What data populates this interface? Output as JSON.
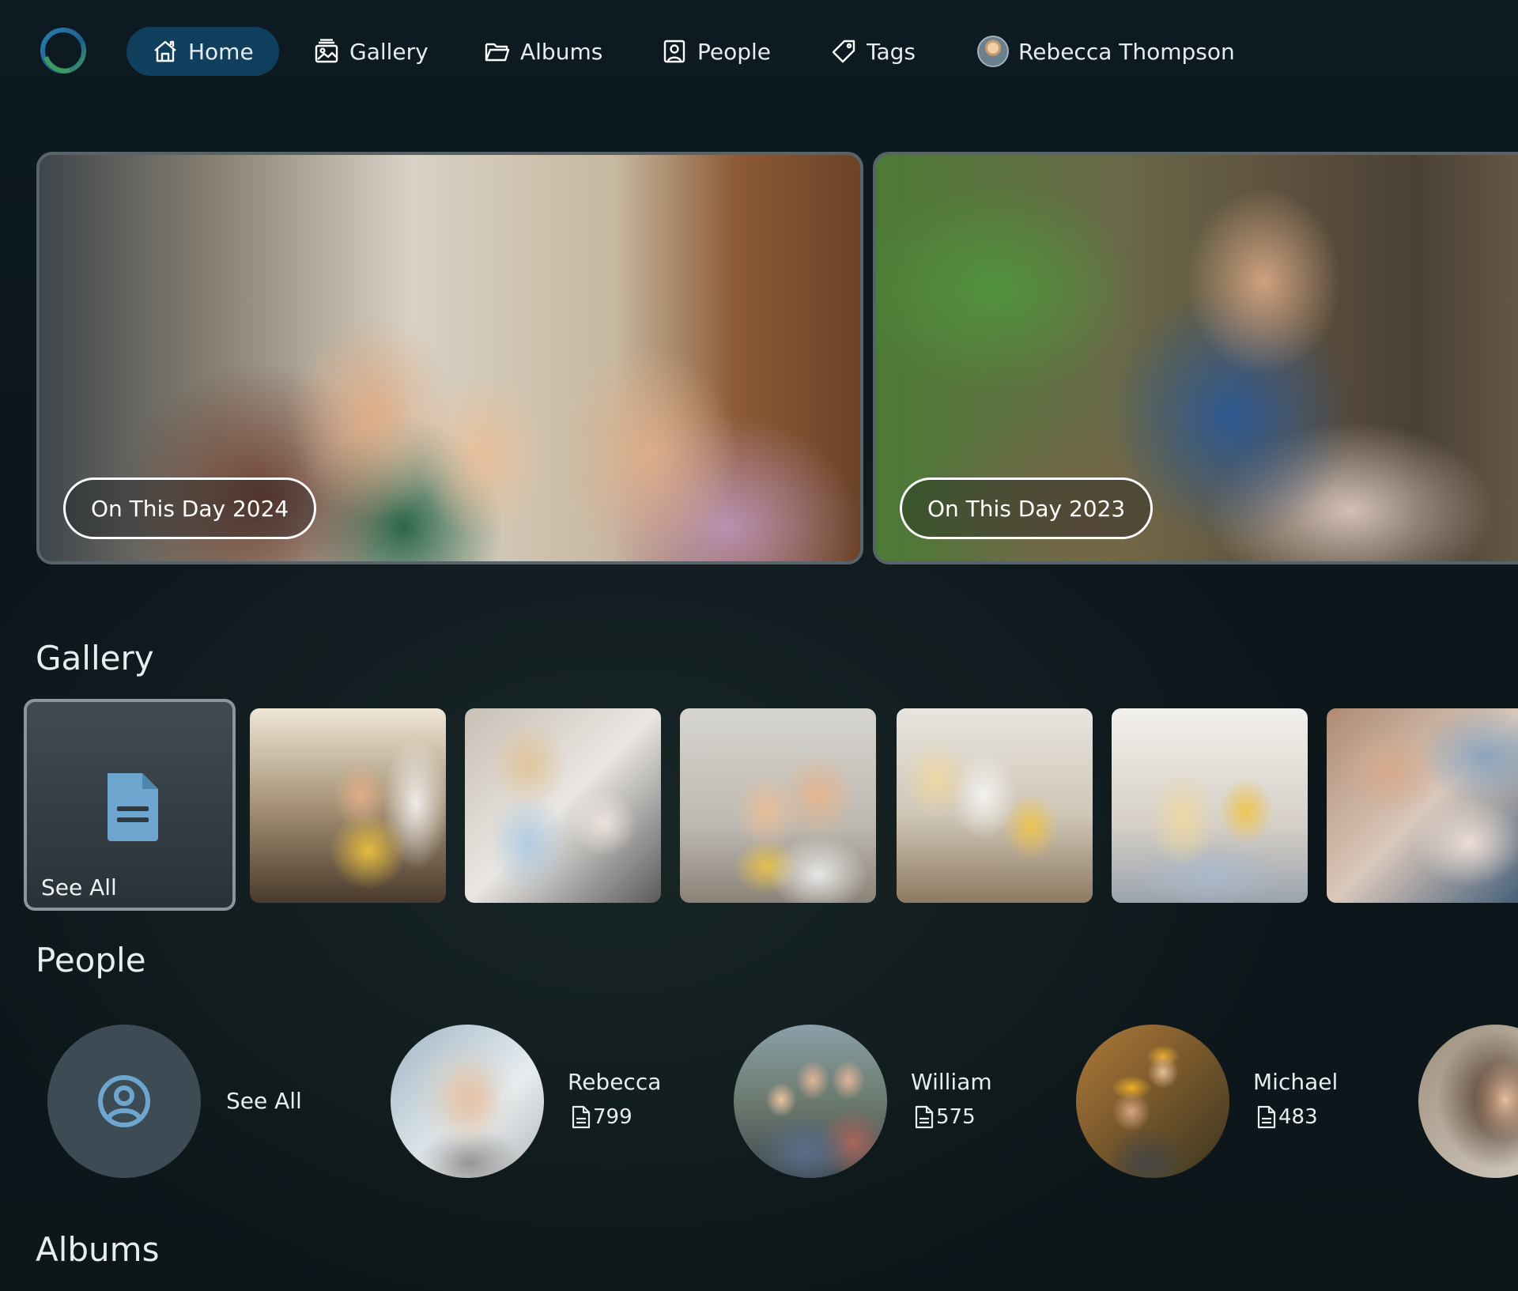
{
  "nav": {
    "items": [
      {
        "label": "Home",
        "icon": "home-icon",
        "active": true
      },
      {
        "label": "Gallery",
        "icon": "gallery-icon",
        "active": false
      },
      {
        "label": "Albums",
        "icon": "folder-icon",
        "active": false
      },
      {
        "label": "People",
        "icon": "person-badge-icon",
        "active": false
      },
      {
        "label": "Tags",
        "icon": "tag-icon",
        "active": false
      }
    ],
    "user_name": "Rebecca Thompson"
  },
  "colors": {
    "accent": "#0f3f5c",
    "background": "#0d161b",
    "icon_blue": "#6da6cf"
  },
  "hero": {
    "cards": [
      {
        "label": "On This Day 2024"
      },
      {
        "label": "On This Day 2023"
      }
    ]
  },
  "gallery": {
    "title": "Gallery",
    "see_all_label": "See All"
  },
  "people": {
    "title": "People",
    "see_all_label": "See All",
    "items": [
      {
        "name": "Rebecca",
        "count": "799"
      },
      {
        "name": "William",
        "count": "575"
      },
      {
        "name": "Michael",
        "count": "483"
      }
    ]
  },
  "albums": {
    "title": "Albums"
  }
}
